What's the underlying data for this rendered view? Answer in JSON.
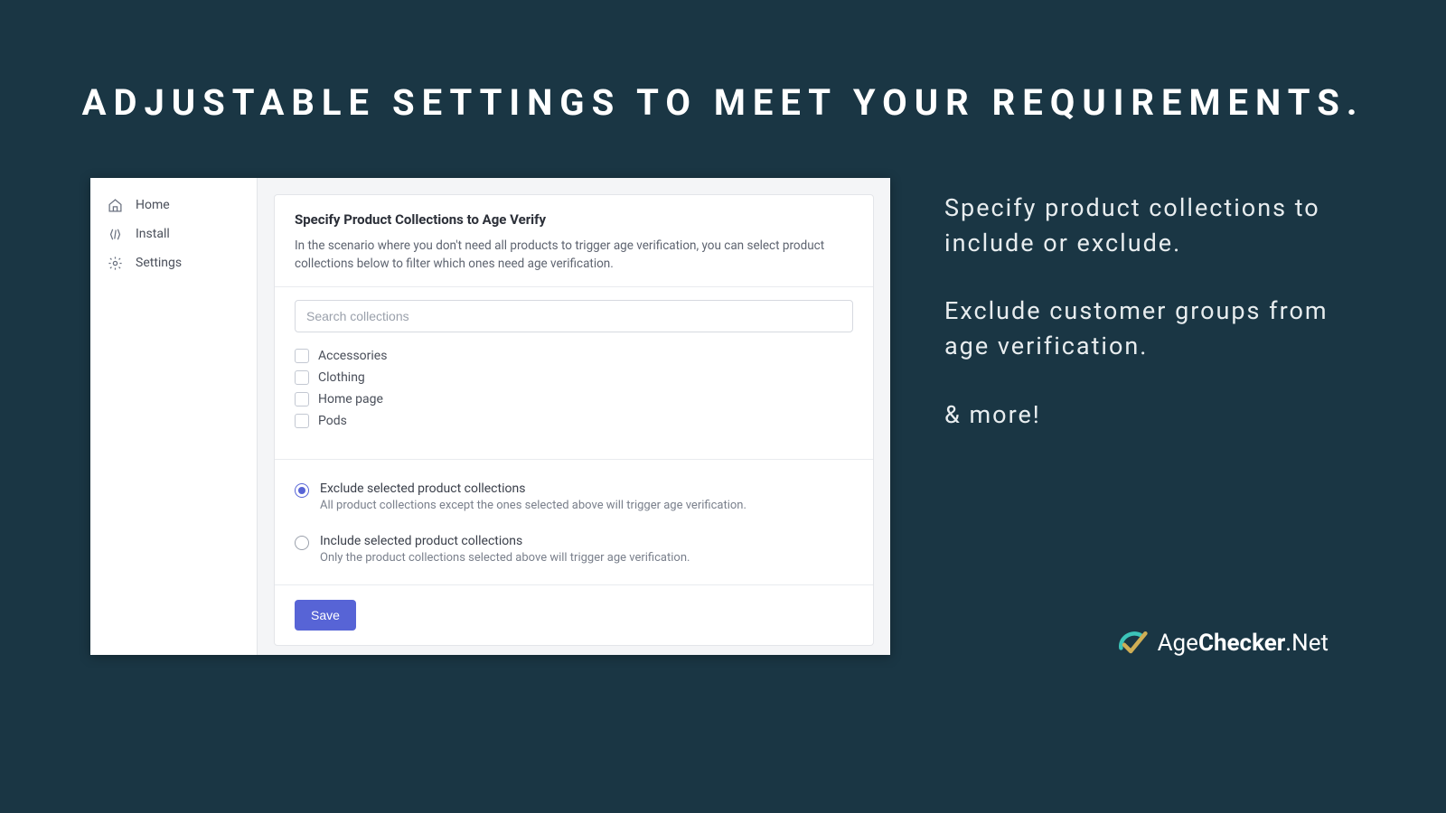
{
  "hero": {
    "title": "ADJUSTABLE SETTINGS TO MEET YOUR REQUIREMENTS."
  },
  "sidebar": {
    "items": [
      {
        "label": "Home"
      },
      {
        "label": "Install"
      },
      {
        "label": "Settings"
      }
    ]
  },
  "card": {
    "title": "Specify Product Collections to Age Verify",
    "desc": "In the scenario where you don't need all products to trigger age verification, you can select product collections below to filter which ones need age verification.",
    "search_placeholder": "Search collections",
    "collections": [
      {
        "label": "Accessories"
      },
      {
        "label": "Clothing"
      },
      {
        "label": "Home page"
      },
      {
        "label": "Pods"
      }
    ],
    "radios": [
      {
        "label": "Exclude selected product collections",
        "sub": "All product collections except the ones selected above will trigger age verification.",
        "selected": true
      },
      {
        "label": "Include selected product collections",
        "sub": "Only the product collections selected above will trigger age verification.",
        "selected": false
      }
    ],
    "save_label": "Save"
  },
  "side_copy": {
    "p1": "Specify product collections to include or exclude.",
    "p2": "Exclude customer groups from age verification.",
    "p3": "& more!"
  },
  "brand": {
    "part1": "Age",
    "part2": "Checker",
    "part3": ".Net"
  }
}
